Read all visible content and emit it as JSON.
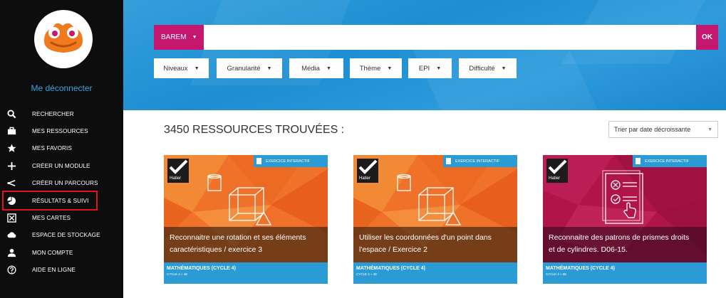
{
  "sidebar": {
    "logout_label": "Me déconnecter",
    "items": [
      {
        "icon": "search-icon",
        "label": "RECHERCHER"
      },
      {
        "icon": "briefcase-icon",
        "label": "MES RESSOURCES"
      },
      {
        "icon": "star-icon",
        "label": "MES FAVORIS"
      },
      {
        "icon": "plus-icon",
        "label": "CRÉER UN MODULE"
      },
      {
        "icon": "route-icon",
        "label": "CRÉER UN PARCOURS"
      },
      {
        "icon": "chart-pie-icon",
        "label": "RÉSULTATS & SUIVI",
        "highlighted": true
      },
      {
        "icon": "cards-icon",
        "label": "MES CARTES"
      },
      {
        "icon": "cloud-icon",
        "label": "ESPACE DE STOCKAGE"
      },
      {
        "icon": "user-icon",
        "label": "MON COMPTE"
      },
      {
        "icon": "help-icon",
        "label": "AIDE EN LIGNE"
      }
    ]
  },
  "search": {
    "scope_label": "BAREM",
    "value": "",
    "placeholder": "",
    "submit_label": "OK"
  },
  "filters": [
    "Niveaux",
    "Granularité",
    "Média",
    "Thème",
    "EPI",
    "Difficulté"
  ],
  "results": {
    "title": "3450 RESSOURCES TROUVÉES :",
    "sort_label": "Trier par date décroissante"
  },
  "cards": [
    {
      "badge": "EXERCICE INTERACTIF",
      "publisher": "Hatier",
      "title_line1": "Reconnaitre une rotation et ses éléments",
      "title_line2": "caractéristiques / exercice 3",
      "subject": "MATHÉMATIQUES (CYCLE 4)",
      "level": "CYCLE 4 » 4E",
      "theme_color": "#f0722a"
    },
    {
      "badge": "EXERCICE INTERACTIF",
      "publisher": "Hatier",
      "title_line1": "Utiliser les coordonnées d'un point dans",
      "title_line2": "l'espace / Exercice 2",
      "subject": "MATHÉMATIQUES (CYCLE 4)",
      "level": "CYCLE 4 » 4E",
      "theme_color": "#f0722a"
    },
    {
      "badge": "EXERCICE INTERACTIF",
      "publisher": "Hatier",
      "title_line1": "Reconnaitre des patrons de prismes droits",
      "title_line2": "et de cylindres. D06-15.",
      "subject": "MATHÉMATIQUES (CYCLE 4)",
      "level": "CYCLE 4 » 5E",
      "theme_color": "#b0154a"
    }
  ],
  "colors": {
    "accent": "#c6176f",
    "header_blue": "#2d9bdc",
    "card_blue": "#2b9bd6",
    "highlight_red": "#e0141d",
    "sidebar_bg": "#0d0d0d"
  }
}
